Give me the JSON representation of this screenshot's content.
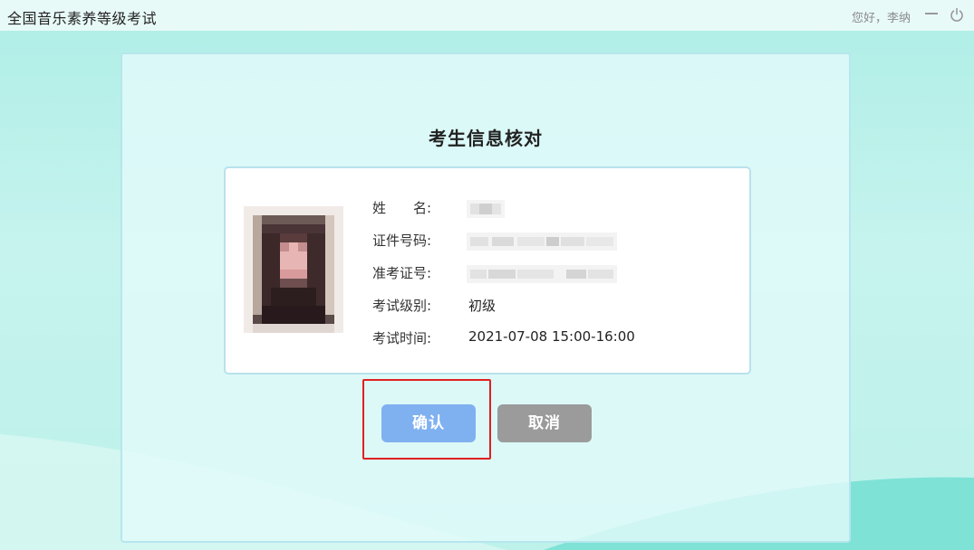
{
  "window": {
    "title": "全国音乐素养等级考试",
    "greeting": "您好，李纳"
  },
  "panel": {
    "title": "考生信息核对",
    "fields": [
      {
        "label": "姓　　名:",
        "value": ""
      },
      {
        "label": "证件号码:",
        "value": ""
      },
      {
        "label": "准考证号:",
        "value": ""
      },
      {
        "label": "考试级别:",
        "value": "初级"
      },
      {
        "label": "考试时间:",
        "value": "2021-07-08 15:00-16:00"
      }
    ]
  },
  "buttons": {
    "confirm": "确认",
    "cancel": "取消"
  },
  "colors": {
    "confirm_bg": "#7fb0f0",
    "cancel_bg": "#9b9b9b",
    "highlight": "#e02020"
  },
  "icons": [
    "minimize-icon",
    "power-icon"
  ]
}
